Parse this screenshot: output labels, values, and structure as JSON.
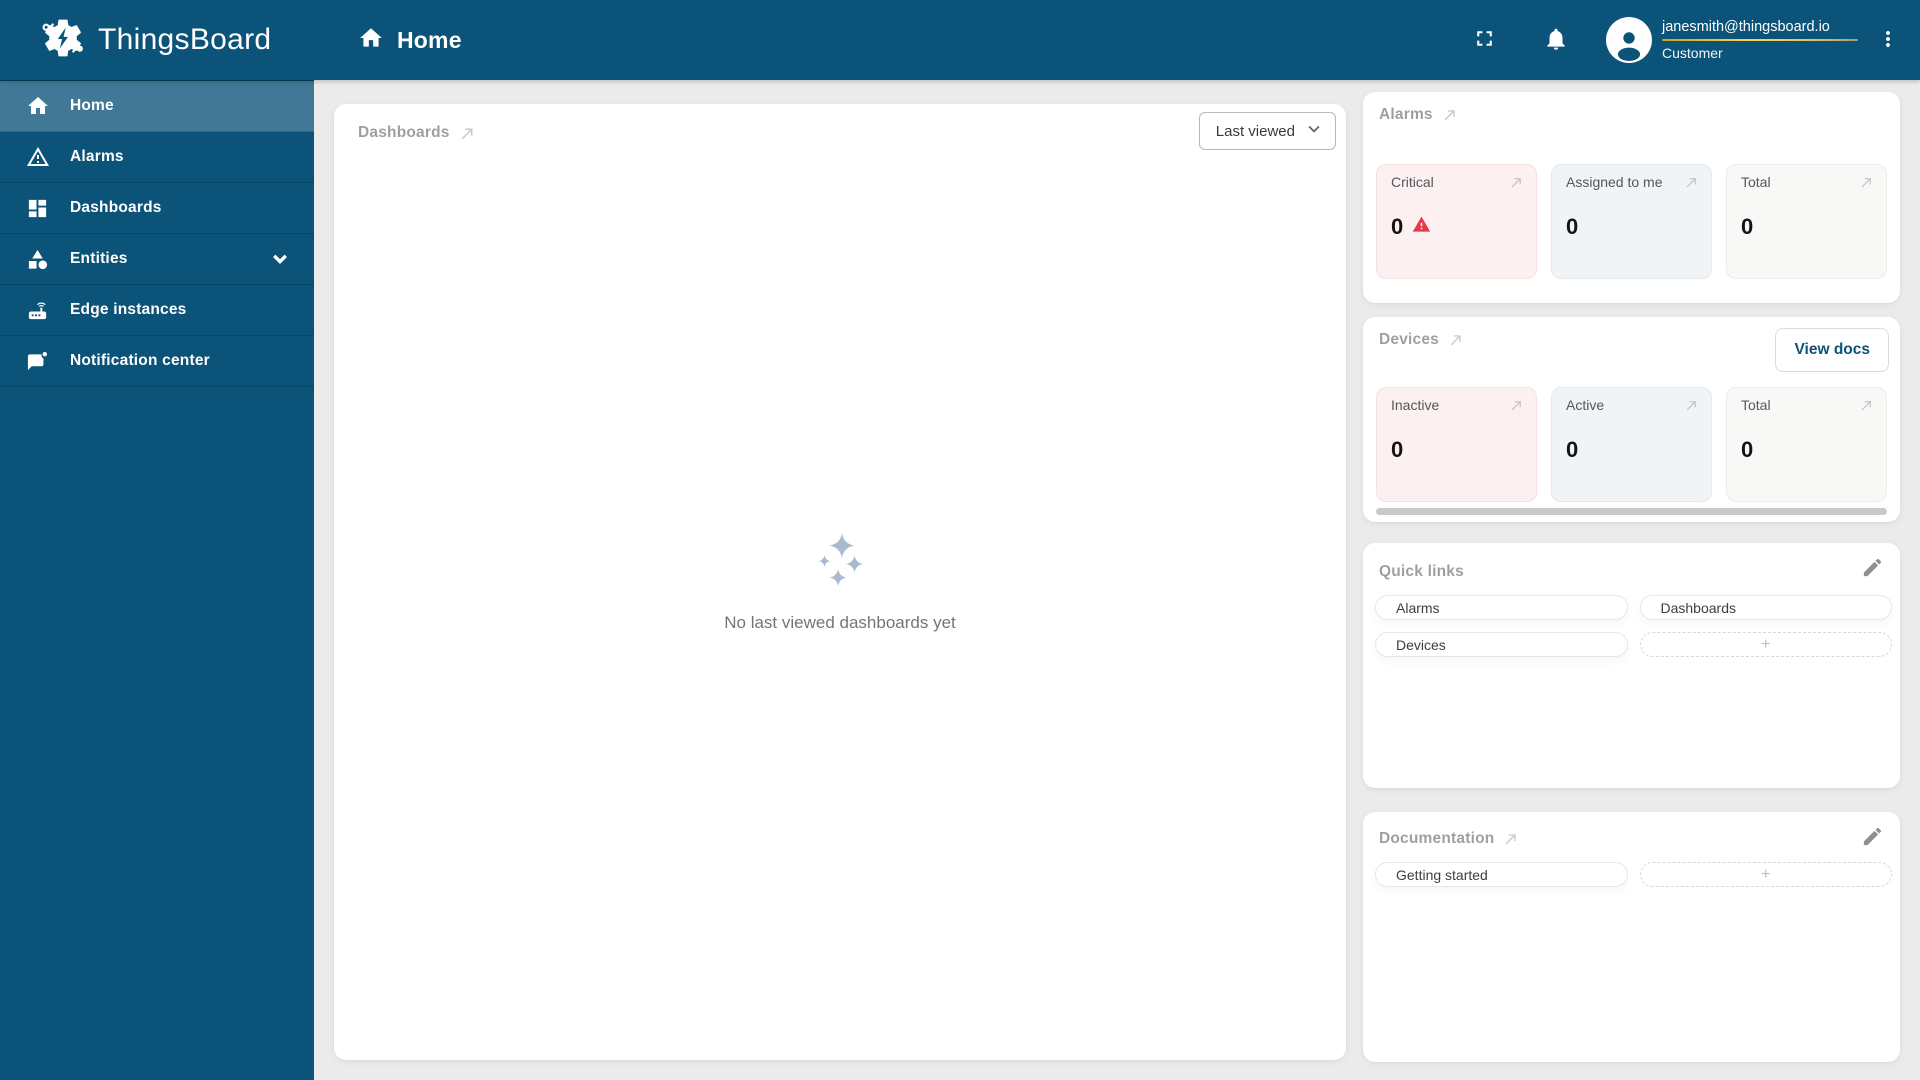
{
  "app": {
    "name": "ThingsBoard"
  },
  "header": {
    "breadcrumb": "Home",
    "user": {
      "email": "janesmith@thingsboard.io",
      "role": "Customer"
    }
  },
  "sidebar": {
    "items": [
      {
        "label": "Home",
        "selected": true
      },
      {
        "label": "Alarms"
      },
      {
        "label": "Dashboards"
      },
      {
        "label": "Entities",
        "expandable": true
      },
      {
        "label": "Edge instances"
      },
      {
        "label": "Notification center"
      }
    ]
  },
  "main": {
    "dashboards_widget": {
      "title": "Dashboards",
      "filter_value": "Last viewed",
      "empty_text": "No last viewed dashboards yet"
    }
  },
  "right_column": {
    "alarms_widget": {
      "title": "Alarms",
      "cards": [
        {
          "label": "Critical",
          "value": "0",
          "has_alert_icon": true
        },
        {
          "label": "Assigned to me",
          "value": "0"
        },
        {
          "label": "Total",
          "value": "0"
        }
      ]
    },
    "devices_widget": {
      "title": "Devices",
      "view_docs_label": "View docs",
      "cards": [
        {
          "label": "Inactive",
          "value": "0"
        },
        {
          "label": "Active",
          "value": "0"
        },
        {
          "label": "Total",
          "value": "0"
        }
      ]
    },
    "quick_links_widget": {
      "title": "Quick links",
      "links": [
        "Alarms",
        "Dashboards",
        "Devices"
      ],
      "add_label": "+"
    },
    "documentation_widget": {
      "title": "Documentation",
      "links": [
        "Getting started"
      ],
      "add_label": "+"
    }
  },
  "colors": {
    "primary_blue": "#0b5379",
    "critical_tint": "#fdf0f0",
    "alert_red": "#e13b47",
    "account_underline_gold": "#ffd34d",
    "empty_sparkles": "#a7bace"
  }
}
